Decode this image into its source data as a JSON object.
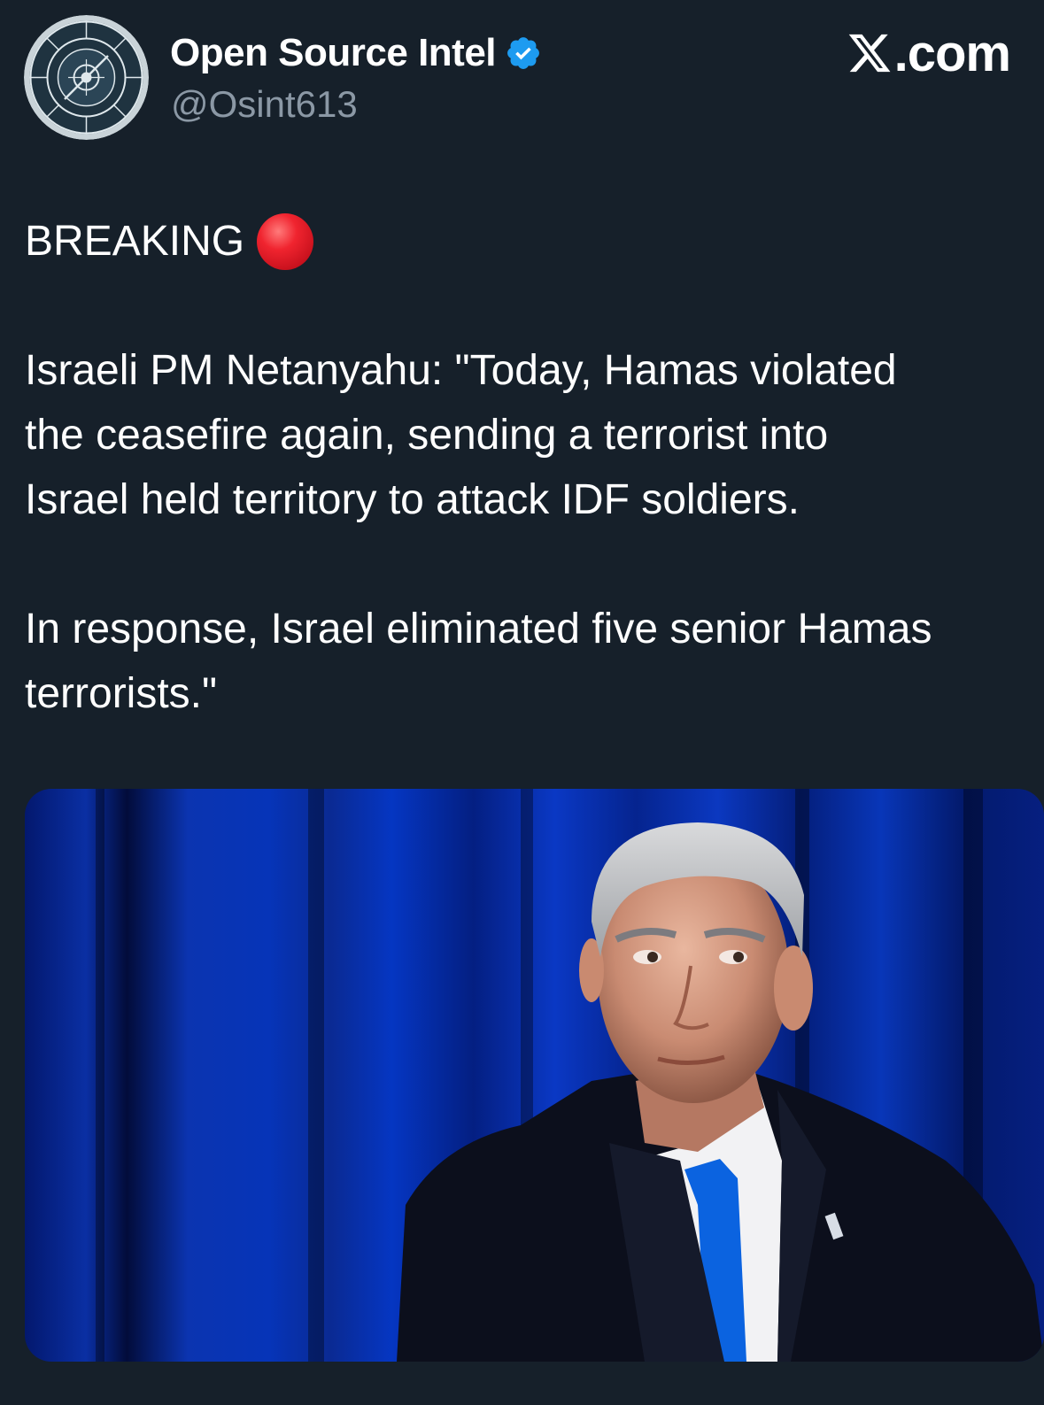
{
  "author": {
    "display_name": "Open Source Intel",
    "handle": "@Osint613",
    "avatar_icon": "osint-compass-logo",
    "verified_icon": "verified-badge-icon"
  },
  "brand": {
    "logo_icon": "x-logo-icon",
    "label": ".com"
  },
  "tweet": {
    "line1": "BREAKING",
    "emoji": "red-circle-icon",
    "para2_line1": "Israeli PM Netanyahu: \"Today, Hamas violated",
    "para2_line2": "the ceasefire again, sending a terrorist into",
    "para2_line3": "Israel held territory to attack IDF soldiers.",
    "para3_line1": "In response, Israel eliminated five senior Hamas",
    "para3_line2": "terrorists.\""
  },
  "colors": {
    "background": "#16202a",
    "handle_gray": "#8b98a5",
    "verified_blue": "#1d9bf0",
    "curtain_blue": "#0b2fa8"
  }
}
